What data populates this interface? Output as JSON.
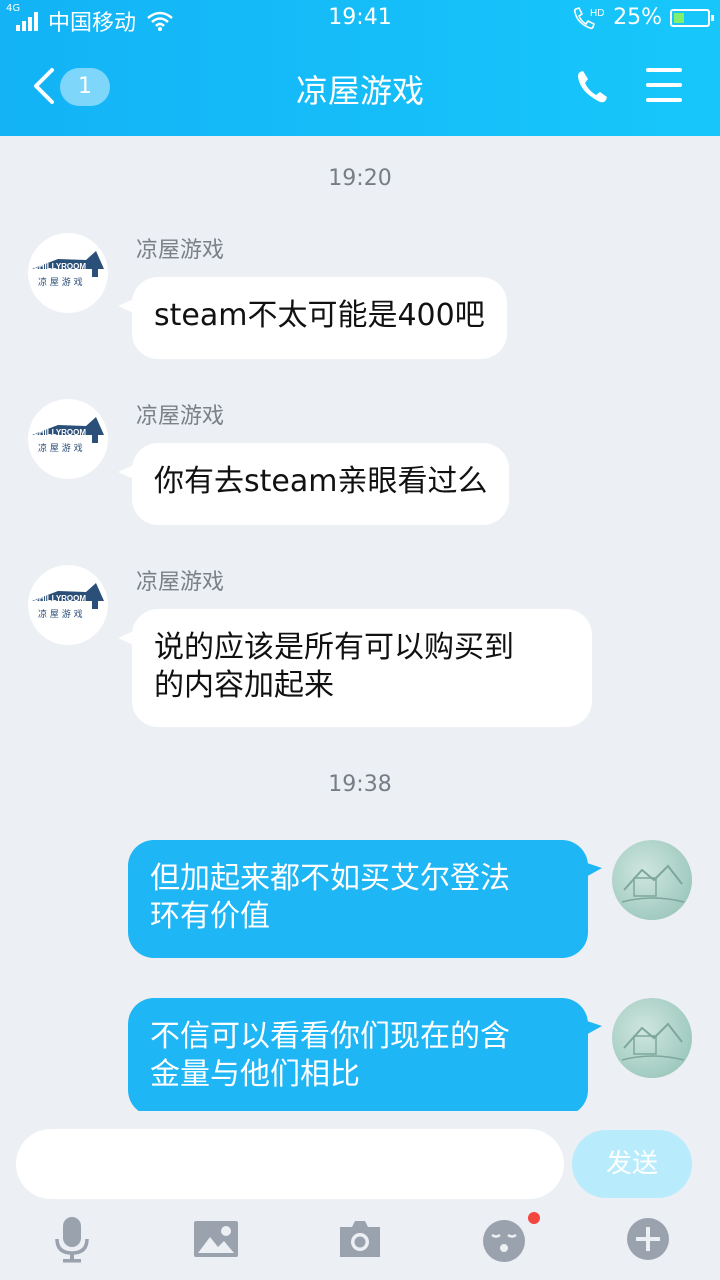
{
  "status_bar": {
    "network": "4G",
    "carrier": "中国移动",
    "time": "19:41",
    "hd": "HD",
    "battery": "25%"
  },
  "header": {
    "unread_count": "1",
    "title": "凉屋游戏"
  },
  "messages": [
    {
      "type": "timestamp",
      "text": "19:20"
    },
    {
      "direction": "in",
      "sender": "凉屋游戏",
      "text": "steam不太可能是400吧"
    },
    {
      "direction": "in",
      "sender": "凉屋游戏",
      "text": "你有去steam亲眼看过么"
    },
    {
      "direction": "in",
      "sender": "凉屋游戏",
      "lines": [
        "说的应该是所有可以购买到",
        "的内容加起来"
      ]
    },
    {
      "type": "timestamp",
      "text": "19:38"
    },
    {
      "direction": "out",
      "lines": [
        "但加起来都不如买艾尔登法",
        "环有价值"
      ]
    },
    {
      "direction": "out",
      "lines": [
        "不信可以看看你们现在的含",
        "金量与他们相比"
      ]
    }
  ],
  "avatar_logo": {
    "brand": "CHILLYROOM",
    "sub": "凉 屋 游 戏"
  },
  "input": {
    "value": "",
    "send_label": "发送"
  },
  "toolbar": {
    "icons": [
      "microphone-icon",
      "image-icon",
      "camera-icon",
      "emoji-icon",
      "plus-icon"
    ],
    "emoji_has_badge": true
  },
  "colors": {
    "header": "#17c7fb",
    "outgoing_bubble": "#1fb6f5",
    "incoming_bubble": "#ffffff",
    "background": "#eceff4",
    "send_button": "#b8ebfb",
    "badge": "#f2463f"
  }
}
